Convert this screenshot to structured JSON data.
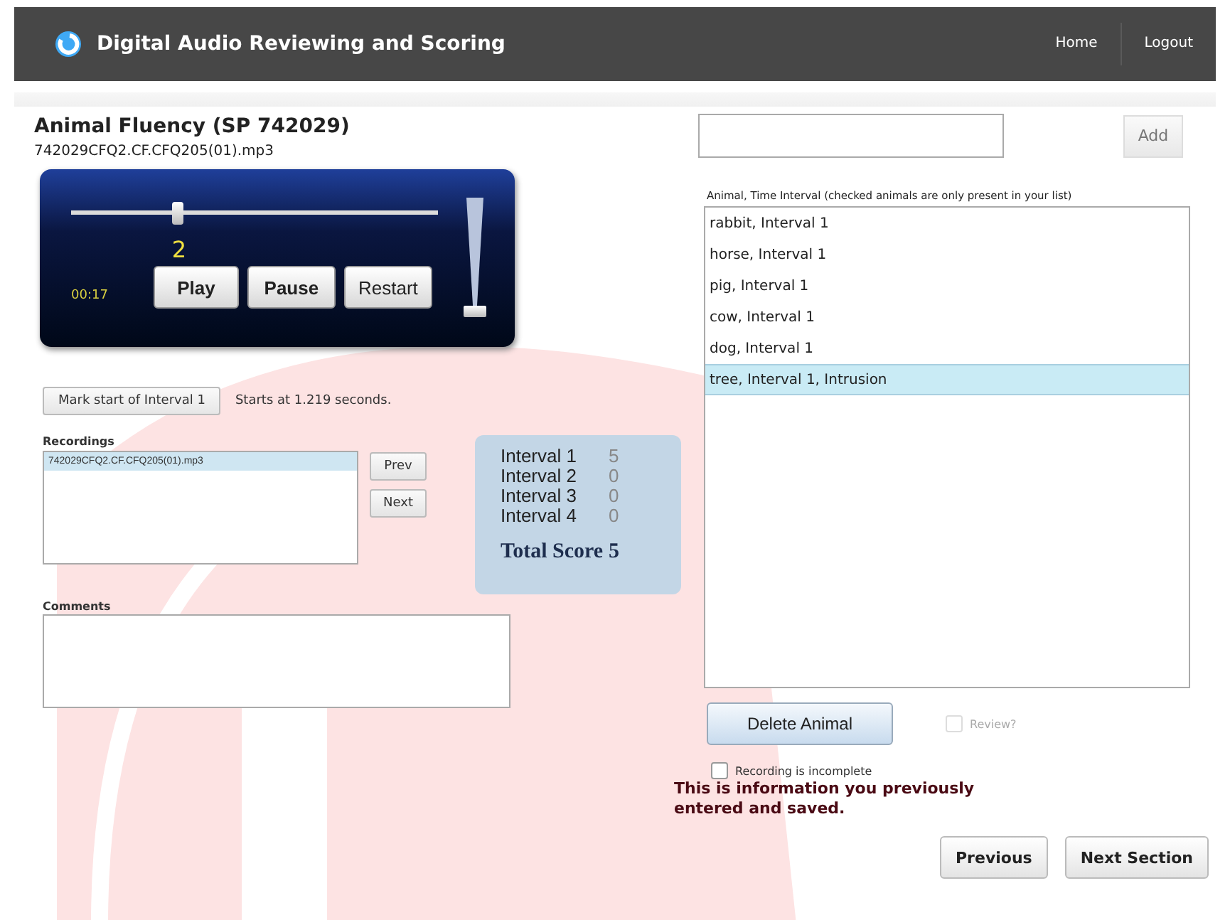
{
  "header": {
    "title": "Digital Audio Reviewing and Scoring",
    "nav": [
      "Home",
      "Logout"
    ]
  },
  "section": {
    "title": "Animal Fluency (SP 742029)",
    "file": "742029CFQ2.CF.CFQ205(01).mp3"
  },
  "player": {
    "position": {
      "level": 0.29,
      "label": "2"
    },
    "time": "00:17",
    "buttons": [
      "Play",
      "Pause",
      "Restart"
    ],
    "volume": {
      "level": 0.0
    }
  },
  "interval": {
    "button": "Mark start of Interval 1",
    "note": "Starts at 1.219 seconds."
  },
  "recordings": {
    "label": "Recordings",
    "items": [
      {
        "name": "742029CFQ2.CF.CFQ205(01).mp3",
        "selected": true
      }
    ],
    "buttons": [
      "Prev",
      "Next"
    ]
  },
  "scores": {
    "rows": [
      {
        "label": "Interval 1",
        "value": "5"
      },
      {
        "label": "Interval 2",
        "value": "0"
      },
      {
        "label": "Interval 3",
        "value": "0"
      },
      {
        "label": "Interval 4",
        "value": "0"
      }
    ],
    "total_label": "Total Score",
    "total": "5"
  },
  "comments": {
    "label": "Comments"
  },
  "add": {
    "button": "Add"
  },
  "animals": {
    "label": "Animal, Time Interval (checked animals are only present in your list)",
    "items": [
      {
        "text": "rabbit, Interval 1",
        "selected": false
      },
      {
        "text": "horse, Interval 1",
        "selected": false
      },
      {
        "text": "pig, Interval 1",
        "selected": false
      },
      {
        "text": "cow, Interval 1",
        "selected": false
      },
      {
        "text": "dog, Interval 1",
        "selected": false
      },
      {
        "text": "tree, Interval 1, Intrusion",
        "selected": true
      }
    ]
  },
  "delete_button": "Delete Animal",
  "review": {
    "label": "Review?",
    "checked": false,
    "disabled": true
  },
  "incomplete": {
    "label": "Recording is incomplete",
    "checked": false
  },
  "info": "This is information you previously entered and saved.",
  "footer_buttons": [
    "Previous",
    "Next Section"
  ]
}
